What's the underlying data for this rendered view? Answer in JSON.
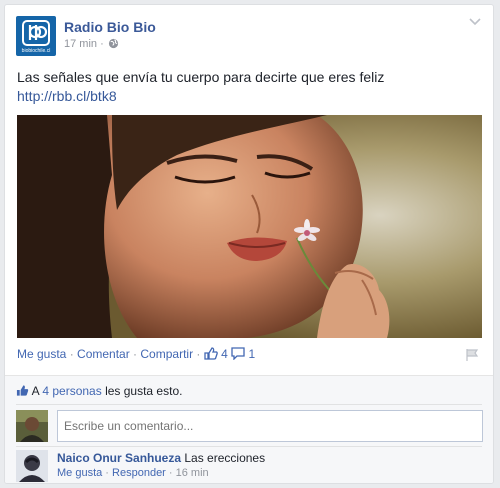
{
  "post": {
    "page_name": "Radio Bio Bio",
    "avatar_caption": "biobiochile.cl",
    "timestamp": "17 min",
    "separator": " · ",
    "text": "Las señales que envía tu cuerpo para decirte que eres feliz",
    "link": "http://rbb.cl/btk8"
  },
  "actions": {
    "like": "Me gusta",
    "comment": "Comentar",
    "share": "Compartir",
    "dot": " · ",
    "like_count": "4",
    "comment_count": "1"
  },
  "likes_summary": {
    "prefix": "A ",
    "people": "4 personas",
    "suffix": " les gusta esto."
  },
  "comment_box": {
    "placeholder": "Escribe un comentario..."
  },
  "comments": [
    {
      "author": "Naico Onur Sanhueza",
      "text": "Las erecciones",
      "like": "Me gusta",
      "reply": "Responder",
      "time": "16 min",
      "dot": " · "
    }
  ],
  "colors": {
    "link_blue": "#365899",
    "brand_blue": "#1565a8",
    "meta_gray": "#90949c"
  },
  "icons": [
    "bio-bio-logo-icon",
    "globe-icon",
    "chevron-down-icon",
    "thumbs-up-icon",
    "comment-bubble-icon",
    "flag-icon"
  ]
}
